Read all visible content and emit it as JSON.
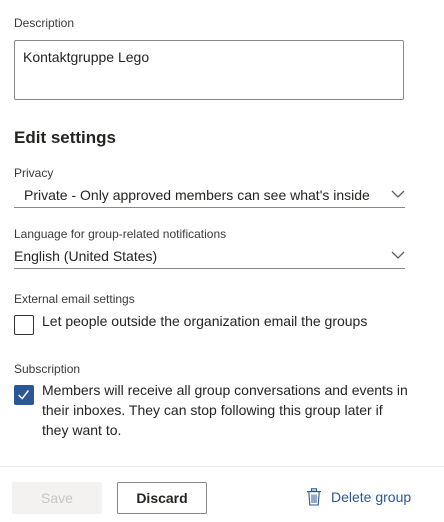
{
  "description": {
    "label": "Description",
    "value": "Kontaktgruppe Lego"
  },
  "edit_settings": {
    "title": "Edit settings"
  },
  "privacy": {
    "label": "Privacy",
    "value": "Private - Only approved members can see what's inside",
    "icon": "chevron-down-icon"
  },
  "language": {
    "label": "Language for group-related notifications",
    "value": "English (United States)",
    "icon": "chevron-down-icon"
  },
  "external_email": {
    "label": "External email settings",
    "checkbox_text": "Let people outside the organization email the groups",
    "checked": false
  },
  "subscription": {
    "label": "Subscription",
    "checkbox_line1": "Members will receive all group conversations and events in",
    "checkbox_line2": "their inboxes. They can stop following this group later if",
    "checkbox_line3": "they want to.",
    "checked": true
  },
  "footer": {
    "save_label": "Save",
    "discard_label": "Discard",
    "delete_label": "Delete group",
    "delete_icon": "trash-icon"
  },
  "colors": {
    "accent": "#2b5797",
    "border": "#8a8886",
    "disabled_bg": "#f3f2f1",
    "disabled_text": "#c8c6c4"
  }
}
